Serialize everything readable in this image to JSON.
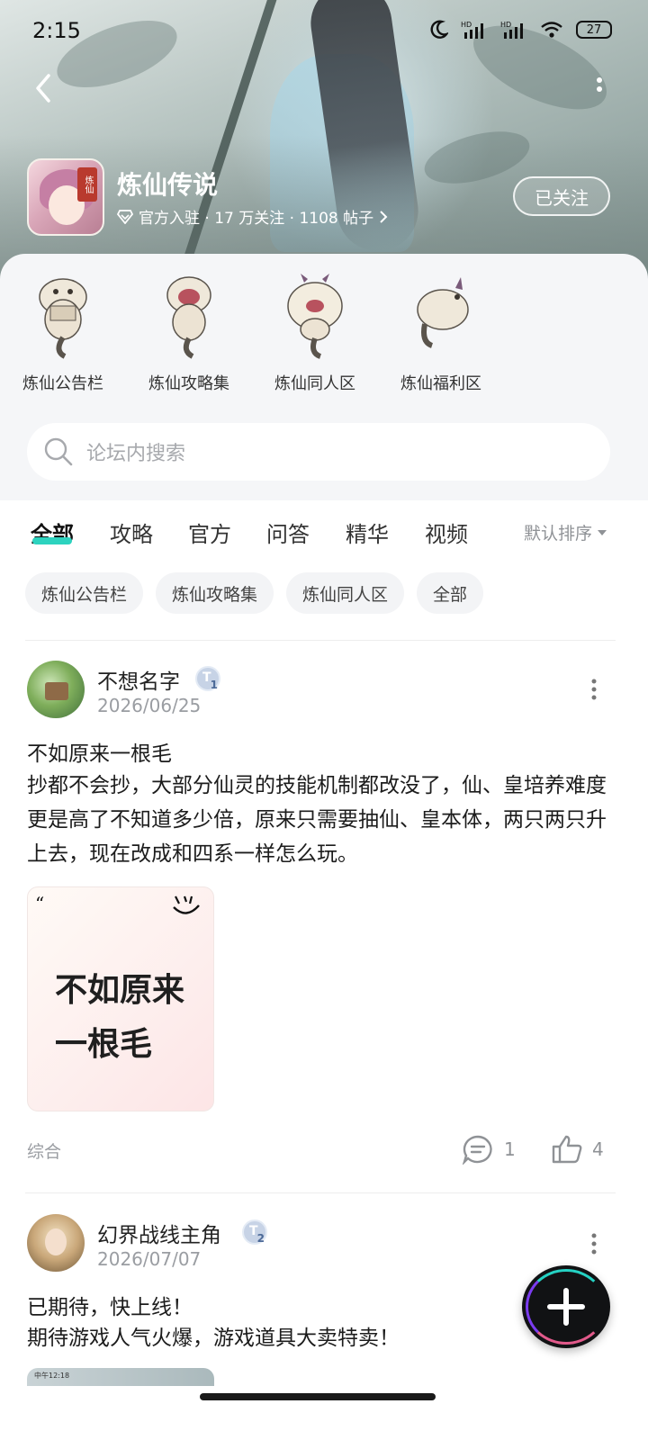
{
  "status": {
    "time": "2:15",
    "battery": "27"
  },
  "game": {
    "title": "炼仙传说",
    "meta": "官方入驻 · 17 万关注 · 1108 帖子",
    "follow_label": "已关注",
    "icon_tag": "炼仙"
  },
  "sections": [
    {
      "label": "炼仙公告栏",
      "icon": "mascot-reading-icon"
    },
    {
      "label": "炼仙攻略集",
      "icon": "mascot-shouting-icon"
    },
    {
      "label": "炼仙同人区",
      "icon": "mascot-fluffy-icon"
    },
    {
      "label": "炼仙福利区",
      "icon": "mascot-flying-icon"
    }
  ],
  "search": {
    "placeholder": "论坛内搜索"
  },
  "tabs": [
    {
      "label": "全部",
      "active": true
    },
    {
      "label": "攻略"
    },
    {
      "label": "官方"
    },
    {
      "label": "问答"
    },
    {
      "label": "精华"
    },
    {
      "label": "视频"
    }
  ],
  "sort_label": "默认排序",
  "chips": [
    "炼仙公告栏",
    "炼仙攻略集",
    "炼仙同人区",
    "全部"
  ],
  "posts": [
    {
      "username": "不想名字",
      "level": "1",
      "date": "2026/06/25",
      "title": "不如原来一根毛",
      "body": "抄都不会抄，大部分仙灵的技能机制都改没了，仙、皇培养难度更是高了不知道多少倍，原来只需要抽仙、皇本体，两只两只升上去，现在改成和四系一样怎么玩。",
      "image_text_line1": "不如原来",
      "image_text_line2": "一根毛",
      "category": "综合",
      "comments": "1",
      "likes": "4"
    },
    {
      "username": "幻界战线主角",
      "level": "2",
      "date": "2026/07/07",
      "title": "已期待，快上线！",
      "body": "期待游戏人气火爆，游戏道具大卖特卖！",
      "thumb_text": "中午12:18"
    }
  ],
  "colors": {
    "accent": "#2dd3bf",
    "fab": "#111214"
  }
}
